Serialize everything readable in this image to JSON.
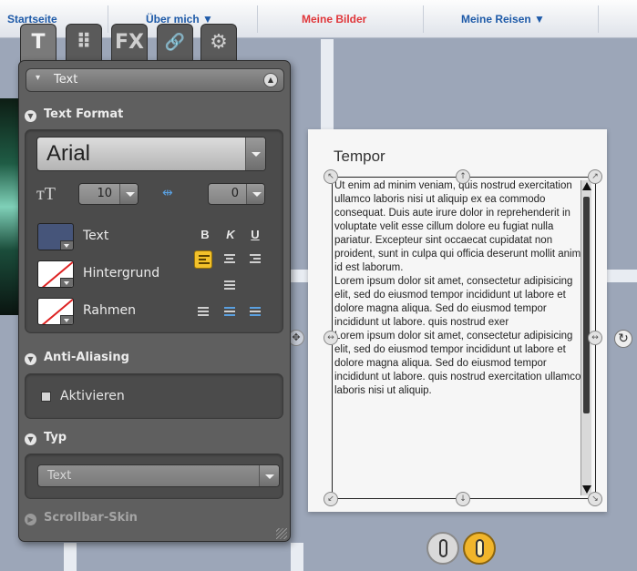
{
  "site_nav": {
    "items": [
      "Startseite",
      "Über mich ▼",
      "Meine Bilder",
      "Meine Reisen ▼"
    ]
  },
  "canvas_text": {
    "title": "Tempor",
    "body": "Ut enim ad minim veniam, quis nostrud exercitation ullamco laboris nisi ut aliquip ex ea commodo consequat. Duis aute irure dolor in reprehenderit in voluptate velit esse cillum dolore eu fugiat nulla pariatur. Excepteur sint occaecat cupidatat non proident, sunt in culpa qui officia deserunt mollit anim id est laborum.\nLorem ipsum dolor sit amet, consectetur adipisicing elit, sed do eiusmod tempor incididunt ut labore et dolore magna aliqua. Sed do eiusmod tempor incididunt ut labore. quis nostrud exer\nLorem ipsum dolor sit amet, consectetur adipisicing elit, sed do eiusmod tempor incididunt ut labore et dolore magna aliqua. Sed do eiusmod tempor incididunt ut labore. quis nostrud exercitation ullamco laboris nisi ut aliquip."
  },
  "panel": {
    "tabs": [
      {
        "glyph": "T",
        "icon": "text-tool-icon",
        "active": true
      },
      {
        "glyph": "⠿",
        "icon": "grid-icon",
        "active": false
      },
      {
        "glyph": "FX",
        "icon": "fx-icon",
        "active": false
      },
      {
        "glyph": "🔗",
        "icon": "link-icon",
        "active": false
      },
      {
        "glyph": "⚙",
        "icon": "settings-icon",
        "active": false
      }
    ],
    "header_label": "Text",
    "sections": {
      "text_format": "Text Format",
      "anti_aliasing": "Anti-Aliasing",
      "typ": "Typ",
      "scrollbar_skin": "Scrollbar-Skin"
    },
    "font_family": "Arial",
    "font_size": "10",
    "letter_spacing": "0",
    "colors": {
      "text_label": "Text",
      "text_color": "#46557a",
      "background_label": "Hintergrund",
      "border_label": "Rahmen"
    },
    "format_buttons": {
      "bold": "B",
      "italic": "K",
      "underline": "U"
    },
    "anti_aliasing_label": "Aktivieren",
    "typ_value": "Text"
  }
}
